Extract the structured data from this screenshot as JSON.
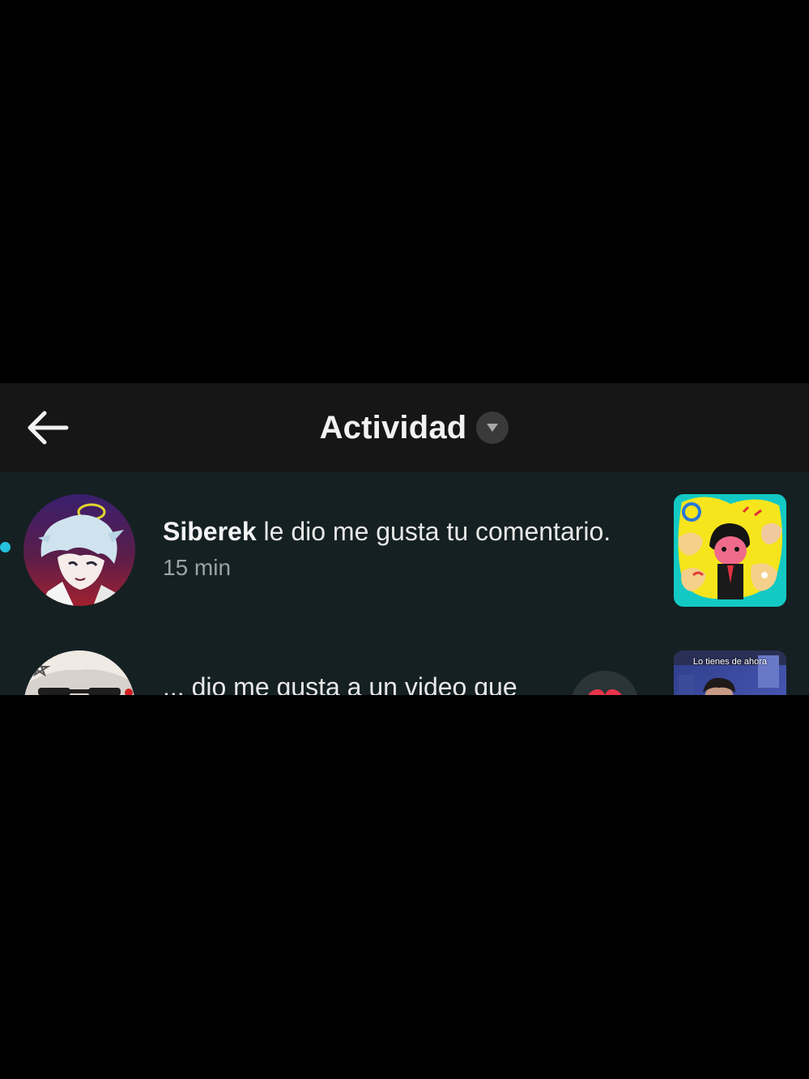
{
  "header": {
    "title": "Actividad",
    "back_icon": "arrow-left-icon",
    "dropdown_icon": "caret-down-icon"
  },
  "notifications": [
    {
      "username": "Siberek",
      "message": " le dio me gusta tu comentario.",
      "time": "15 min",
      "unread": true,
      "thumbnail_icon": "cartoon-collage-thumbnail"
    },
    {
      "message": "... dio me gusta a un video que",
      "thumbnail_caption": "Lo tienes de ahora",
      "like_icon": "heart-icon"
    }
  ],
  "colors": {
    "page_background": "#000000",
    "header_background": "#161616",
    "list_background": "#152022",
    "unread_dot": "#25c2dd",
    "like_heart": "#e8344a"
  }
}
